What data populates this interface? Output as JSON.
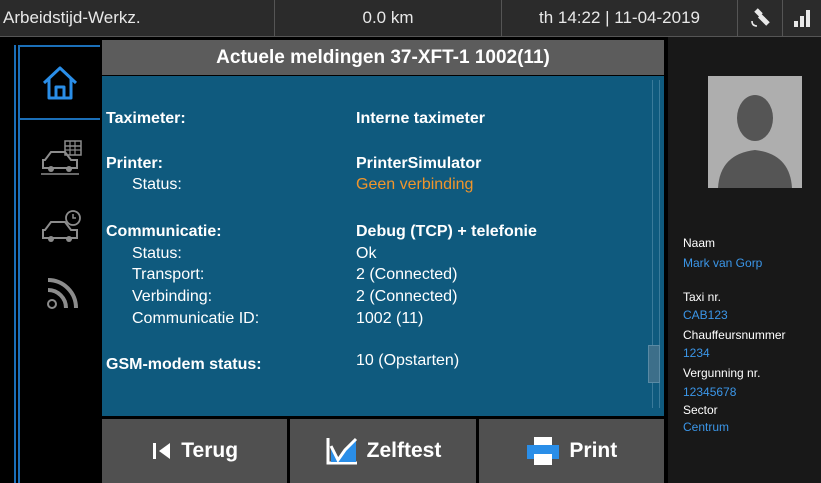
{
  "topbar": {
    "app_name": "Arbeidstijd-Werkz.",
    "distance": "0.0 km",
    "datetime": "th 14:22 | 11-04-2019"
  },
  "header": {
    "title": "Actuele meldingen 37-XFT-1 1002(11)"
  },
  "details": {
    "taximeter_label": "Taximeter:",
    "taximeter_value": "Interne taximeter",
    "printer_label": "Printer:",
    "printer_value": "PrinterSimulator",
    "printer_status_label": "Status:",
    "printer_status_value": "Geen verbinding",
    "comm_label": "Communicatie:",
    "comm_value": "Debug (TCP) + telefonie",
    "comm_status_label": "Status:",
    "comm_status_value": "Ok",
    "transport_label": "Transport:",
    "transport_value": "2 (Connected)",
    "verbinding_label": "Verbinding:",
    "verbinding_value": "2 (Connected)",
    "comm_id_label": "Communicatie ID:",
    "comm_id_value": "1002 (11)",
    "gsm_label": "GSM-modem status:",
    "gsm_value": "10 (Opstarten)"
  },
  "buttons": {
    "back": "Terug",
    "selftest": "Zelftest",
    "print": "Print"
  },
  "driver": {
    "naam_label": "Naam",
    "naam_value": "Mark van Gorp",
    "taxi_label": "Taxi nr.",
    "taxi_value": "CAB123",
    "chauffeur_label": "Chauffeursnummer",
    "chauffeur_value": "1234",
    "vergunning_label": "Vergunning nr.",
    "vergunning_value": "12345678",
    "sector_label": "Sector",
    "sector_value": "Centrum"
  },
  "icons": {
    "nav": [
      "home-icon",
      "car-schedule-icon",
      "car-clock-icon",
      "signal-icon"
    ],
    "status": [
      "gps-satellite-icon",
      "signal-bars-icon"
    ],
    "buttons": [
      "back-arrow-icon",
      "selftest-chart-icon",
      "printer-icon"
    ]
  },
  "colors": {
    "panel": "#0f5a7e",
    "accent": "#1b6fb8",
    "warning": "#f0952b",
    "link": "#3b96e8"
  }
}
